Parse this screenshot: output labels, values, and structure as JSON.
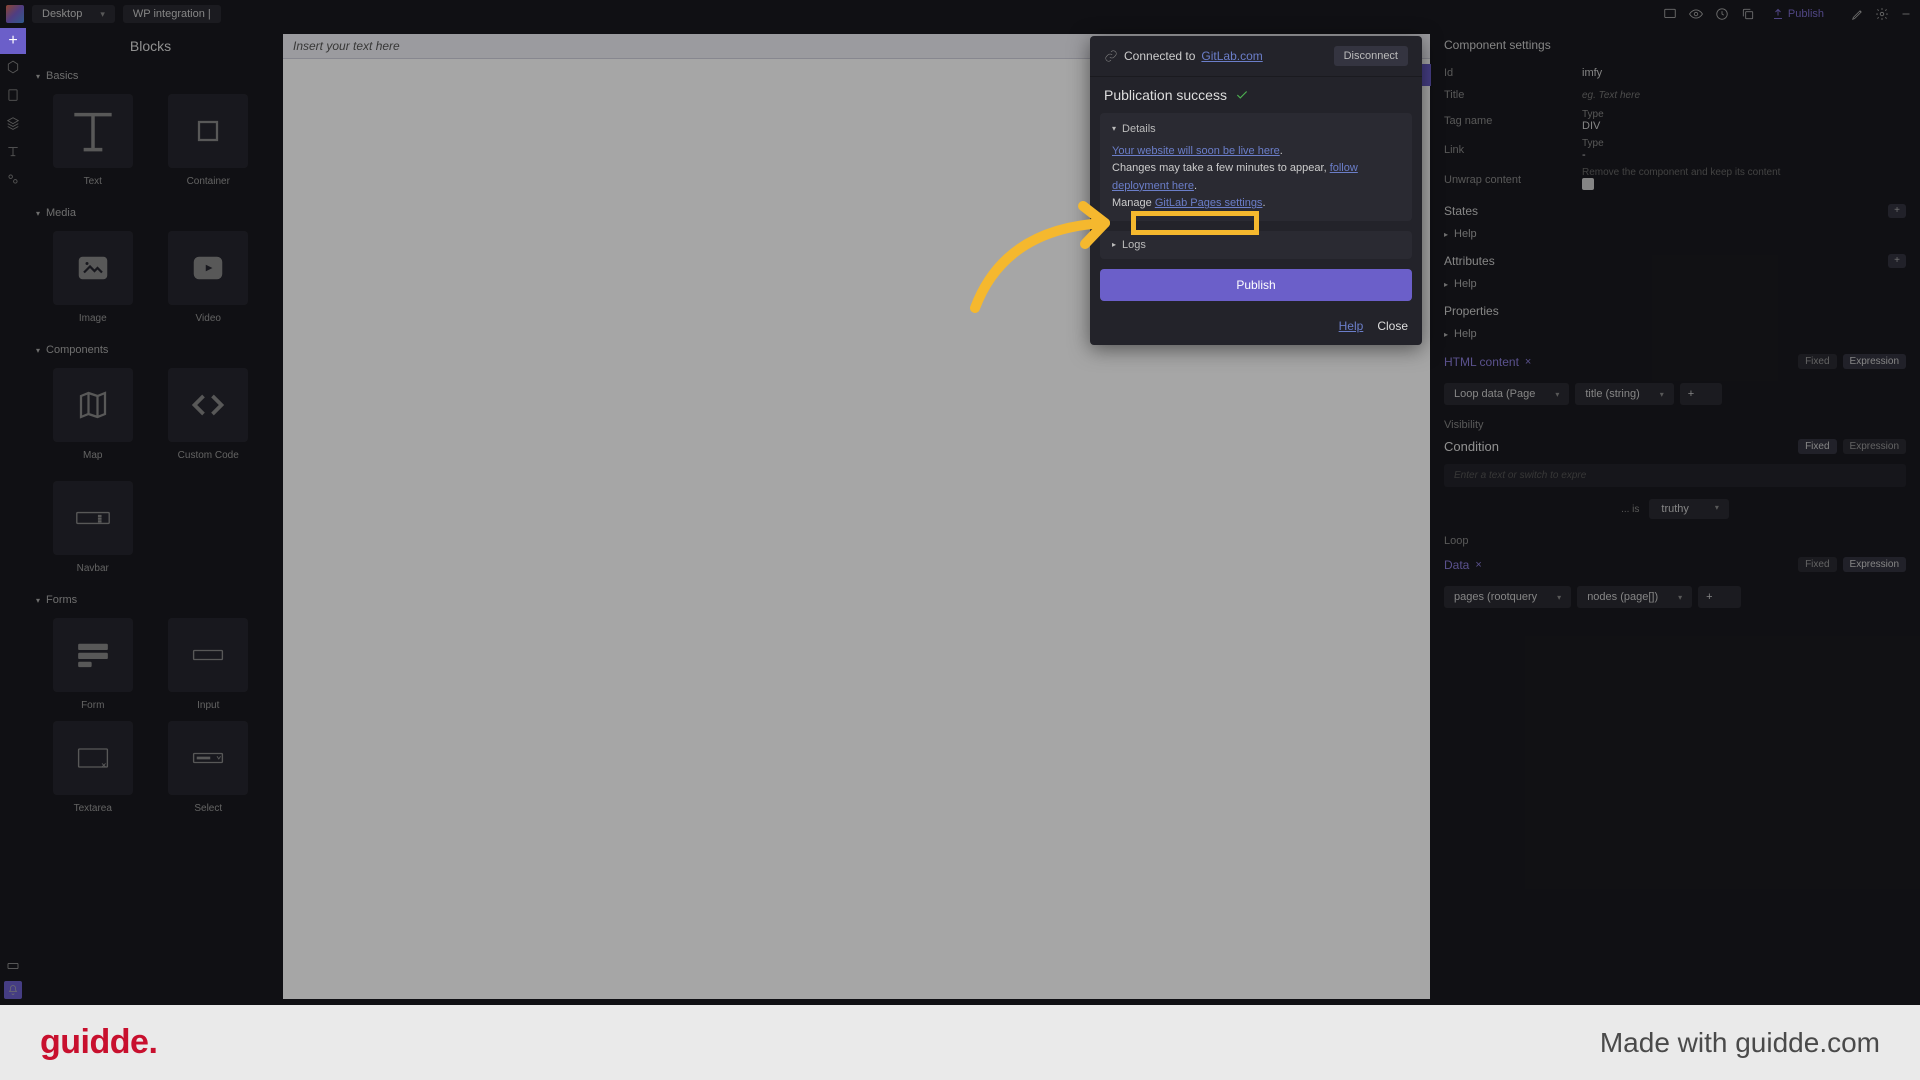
{
  "topbar": {
    "desktop_label": "Desktop",
    "tab_label": "WP integration |",
    "publish_label": "Publish"
  },
  "blocks": {
    "title": "Blocks",
    "sections": {
      "basics": "Basics",
      "media": "Media",
      "components": "Components",
      "forms": "Forms"
    },
    "items": {
      "text": "Text",
      "container": "Container",
      "image": "Image",
      "video": "Video",
      "map": "Map",
      "custom_code": "Custom Code",
      "navbar": "Navbar",
      "form": "Form",
      "input": "Input",
      "textarea": "Textarea",
      "select": "Select"
    }
  },
  "canvas": {
    "placeholder": "Insert your text here"
  },
  "popup": {
    "connected_to": "Connected to",
    "gitlab_host": "GitLab.com",
    "disconnect": "Disconnect",
    "success": "Publication success",
    "details": "Details",
    "live_link": "Your website will soon be live here",
    "changes": "Changes may take a few minutes to appear, ",
    "follow": "follow deployment here",
    "manage": "Manage ",
    "gitlab_settings": "GitLab Pages settings",
    "logs": "Logs",
    "publish_btn": "Publish",
    "help": "Help",
    "close": "Close"
  },
  "right": {
    "title": "Component settings",
    "id_label": "Id",
    "id_val": "imfy",
    "title_label": "Title",
    "title_ph": "eg. Text here",
    "tag_label": "Tag name",
    "type_label": "Type",
    "type_val": "DIV",
    "link_label": "Link",
    "type2_label": "Type",
    "type2_val": "-",
    "unwrap_label": "Unwrap content",
    "unwrap_hint": "Remove the component and keep its content",
    "states": "States",
    "help": "Help",
    "attributes": "Attributes",
    "properties": "Properties",
    "html_content": "HTML content",
    "fixed": "Fixed",
    "expression": "Expression",
    "loop_data": "Loop data (Page",
    "title_string": "title (string)",
    "visibility": "Visibility",
    "condition": "Condition",
    "cond_ph": "Enter a text or switch to expre",
    "is": "... is",
    "truthy": "truthy",
    "loop": "Loop",
    "data": "Data",
    "pages_root": "pages (rootquery",
    "nodes_page": "nodes (page[])"
  },
  "brand": {
    "logo": "guidde",
    "made": "Made with guidde.com"
  }
}
